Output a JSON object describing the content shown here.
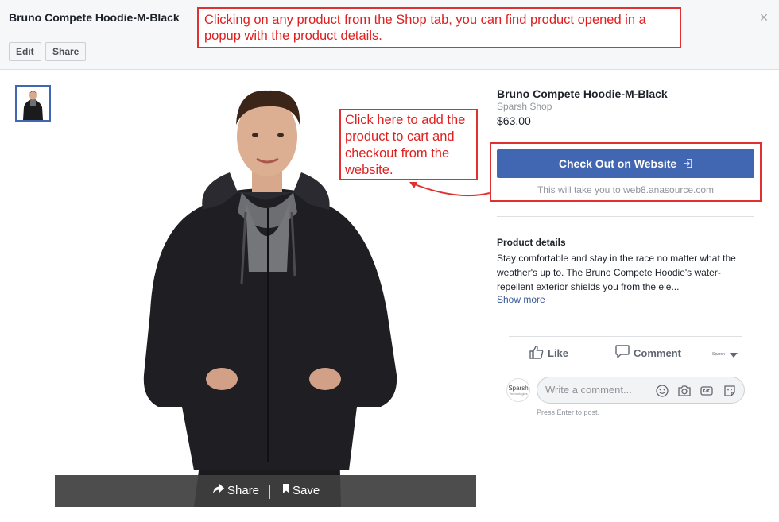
{
  "modal": {
    "title": "Bruno Compete Hoodie-M-Black",
    "close_glyph": "×",
    "edit_label": "Edit",
    "share_label": "Share"
  },
  "image": {
    "share_label": "Share",
    "save_label": "Save"
  },
  "product": {
    "title": "Bruno Compete Hoodie-M-Black",
    "shop": "Sparsh Shop",
    "price": "$63.00",
    "checkout_label": "Check Out on Website",
    "checkout_note": "This will take you to web8.anasource.com",
    "details_heading": "Product details",
    "details_text": "Stay comfortable and stay in the race no matter what the weather's up to. The Bruno Compete Hoodie's water-repellent exterior shields you from the ele...",
    "show_more": "Show more"
  },
  "social": {
    "like_label": "Like",
    "comment_label": "Comment",
    "actor_text": "Sparsh",
    "avatar_text": "Sparsh",
    "avatar_sub": "Technologies",
    "comment_placeholder": "Write a comment...",
    "press_enter": "Press Enter to post."
  },
  "annotations": {
    "top": "Clicking on any product from the Shop tab, you can find product opened in a popup with the product details.",
    "side": "Click here to add the product to cart and checkout from the website."
  },
  "colors": {
    "accent": "#4267b2",
    "annotation": "#e03030",
    "link": "#385898"
  }
}
